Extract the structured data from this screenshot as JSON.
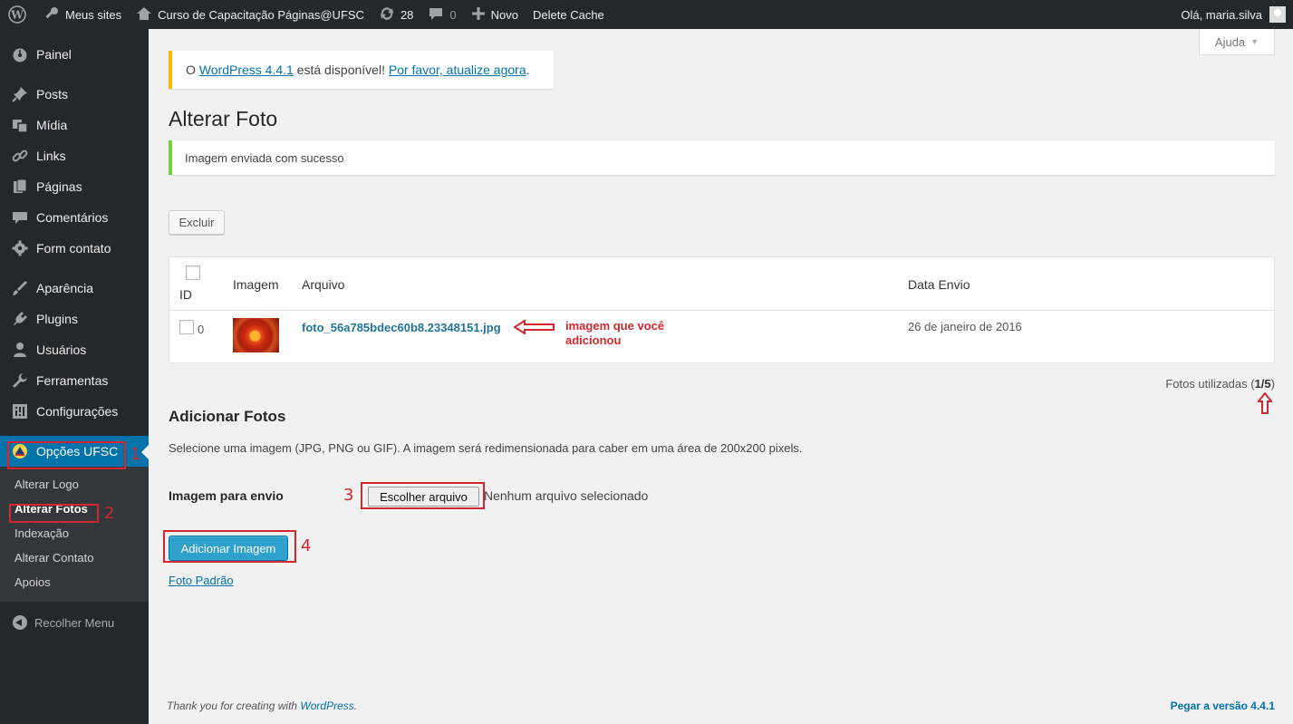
{
  "adminbar": {
    "my_sites": "Meus sites",
    "site_name": "Curso de Capacitação Páginas@UFSC",
    "updates_count": "28",
    "comments_count": "0",
    "new_label": "Novo",
    "delete_cache": "Delete Cache",
    "greeting": "Olá, maria.silva"
  },
  "sidebar": {
    "items": [
      {
        "label": "Painel",
        "icon": "dashboard-icon"
      },
      {
        "label": "Posts",
        "icon": "pin-icon"
      },
      {
        "label": "Mídia",
        "icon": "media-icon"
      },
      {
        "label": "Links",
        "icon": "link-icon"
      },
      {
        "label": "Páginas",
        "icon": "pages-icon"
      },
      {
        "label": "Comentários",
        "icon": "comment-icon"
      },
      {
        "label": "Form contato",
        "icon": "gear-icon"
      },
      {
        "label": "Aparência",
        "icon": "brush-icon"
      },
      {
        "label": "Plugins",
        "icon": "plugin-icon"
      },
      {
        "label": "Usuários",
        "icon": "user-icon"
      },
      {
        "label": "Ferramentas",
        "icon": "wrench-icon"
      },
      {
        "label": "Configurações",
        "icon": "settings-icon"
      },
      {
        "label": "Opções UFSC",
        "icon": "ufsc-logo-icon"
      }
    ],
    "submenu": [
      "Alterar Logo",
      "Alterar Fotos",
      "Indexação",
      "Alterar Contato",
      "Apoios"
    ],
    "collapse": "Recolher Menu"
  },
  "help": {
    "label": "Ajuda"
  },
  "update_notice": {
    "prefix": "O ",
    "link1": "WordPress 4.4.1",
    "middle": " está disponível! ",
    "link2": "Por favor, atualize agora",
    "suffix": "."
  },
  "page": {
    "title": "Alterar Foto",
    "success_message": "Imagem enviada com sucesso",
    "delete_button": "Excluir"
  },
  "table": {
    "columns": {
      "id": "ID",
      "image": "Imagem",
      "file": "Arquivo",
      "date": "Data Envio"
    },
    "rows": [
      {
        "id": "0",
        "file": "foto_56a785bdec60b8.23348151.jpg",
        "date": "26 de janeiro de 2016"
      }
    ]
  },
  "annotation": {
    "image_added_line1": "imagem que você",
    "image_added_line2": "adicionou",
    "step1": "1",
    "step2": "2",
    "step3": "3",
    "step4": "4"
  },
  "usage": {
    "label": "Fotos utilizadas (",
    "value": "1/5",
    "suffix": ")"
  },
  "add_section": {
    "title": "Adicionar Fotos",
    "description": "Selecione uma imagem (JPG, PNG ou GIF). A imagem será redimensionada para caber em uma área de 200x200 pixels.",
    "field_label": "Imagem para envio",
    "choose_file": "Escolher arquivo",
    "no_file": "Nenhum arquivo selecionado",
    "submit": "Adicionar Imagem",
    "default_photo": "Foto Padrão"
  },
  "footer": {
    "thanks_prefix": "Thank you for creating with ",
    "thanks_link": "WordPress",
    "thanks_suffix": ".",
    "version": "Pegar a versão 4.4.1"
  },
  "colors": {
    "accent": "#0073aa",
    "annotation": "#d0282e",
    "notice_warning": "#ffb900",
    "notice_success": "#7ad03a"
  }
}
